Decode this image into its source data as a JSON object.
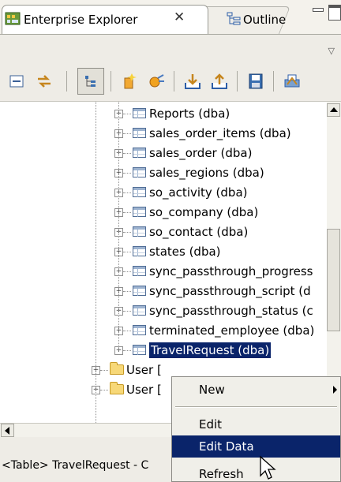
{
  "tabs": [
    {
      "label": "Enterprise Explorer",
      "active": true,
      "close_glyph": "✕"
    },
    {
      "label": "Outline",
      "active": false
    }
  ],
  "view_menu_glyph": "▽",
  "toolbar": {
    "icons": [
      "collapse-all-icon",
      "link-with-editor-icon",
      "hierarchy-icon",
      "new-connection-icon",
      "connect-icon",
      "import-icon",
      "export-icon",
      "save-icon",
      "print-icon"
    ]
  },
  "tree": {
    "rows": [
      {
        "label": "Reports (dba)",
        "type": "table"
      },
      {
        "label": "sales_order_items (dba)",
        "type": "table"
      },
      {
        "label": "sales_order (dba)",
        "type": "table"
      },
      {
        "label": "sales_regions (dba)",
        "type": "table"
      },
      {
        "label": "so_activity (dba)",
        "type": "table"
      },
      {
        "label": "so_company (dba)",
        "type": "table"
      },
      {
        "label": "so_contact (dba)",
        "type": "table"
      },
      {
        "label": "states (dba)",
        "type": "table"
      },
      {
        "label": "sync_passthrough_progress",
        "type": "table"
      },
      {
        "label": "sync_passthrough_script (d",
        "type": "table"
      },
      {
        "label": "sync_passthrough_status (c",
        "type": "table"
      },
      {
        "label": "terminated_employee (dba)",
        "type": "table"
      },
      {
        "label": "TravelRequest (dba)",
        "type": "table",
        "selected": true
      },
      {
        "label": "User [",
        "type": "folder"
      },
      {
        "label": "User [",
        "type": "folder"
      }
    ]
  },
  "status": {
    "text": "<Table> TravelRequest - C"
  },
  "context_menu": {
    "items": [
      {
        "label": "New",
        "submenu": true
      },
      {
        "label": "Edit"
      },
      {
        "label": "Edit Data",
        "highlighted": true
      },
      {
        "label": "Refresh"
      }
    ]
  },
  "colors": {
    "selection": "#0a246a",
    "menu_bg": "#f0efe9",
    "chrome_bg": "#eeece6"
  }
}
